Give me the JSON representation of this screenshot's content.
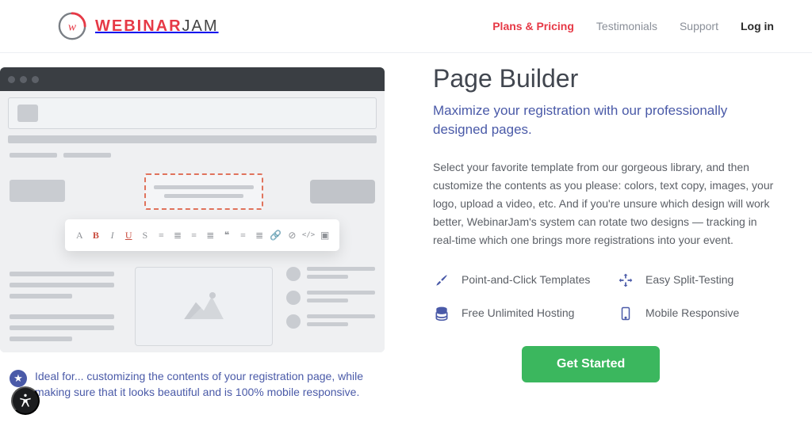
{
  "brand": {
    "name_part1": "WEBINAR",
    "name_part2": "JAM"
  },
  "nav": {
    "plans": "Plans & Pricing",
    "testimonials": "Testimonials",
    "support": "Support",
    "login": "Log in"
  },
  "hero": {
    "title": "Page Builder",
    "subtitle": "Maximize your registration with our professionally designed pages.",
    "body": "Select your favorite template from our gorgeous library, and then customize the contents as you please: colors, text copy, images, your logo, upload a video, etc. And if you're unsure which design will work better, WebinarJam's system can rotate two designs — tracking in real-time which one brings more registrations into your event."
  },
  "features": [
    {
      "icon": "brush-icon",
      "label": "Point-and-Click Templates"
    },
    {
      "icon": "arrows-icon",
      "label": "Easy Split-Testing"
    },
    {
      "icon": "database-icon",
      "label": "Free Unlimited Hosting"
    },
    {
      "icon": "mobile-icon",
      "label": "Mobile Responsive"
    }
  ],
  "cta_label": "Get Started",
  "ideal": {
    "prefix": "Ideal for...",
    "text": " customizing the contents of your registration page, while making sure that it looks beautiful and is 100% mobile responsive."
  },
  "toolbar": {
    "a": "A",
    "b": "B",
    "i": "I",
    "u": "U",
    "strike": "S",
    "alignL": "≡",
    "alignC": "≣",
    "alignR": "≡",
    "justify": "≣",
    "quote": "❝",
    "olist": "≡",
    "ulist": "≣",
    "link": "🔗",
    "unlink": "⊘",
    "code": "</>",
    "img": "▣"
  }
}
